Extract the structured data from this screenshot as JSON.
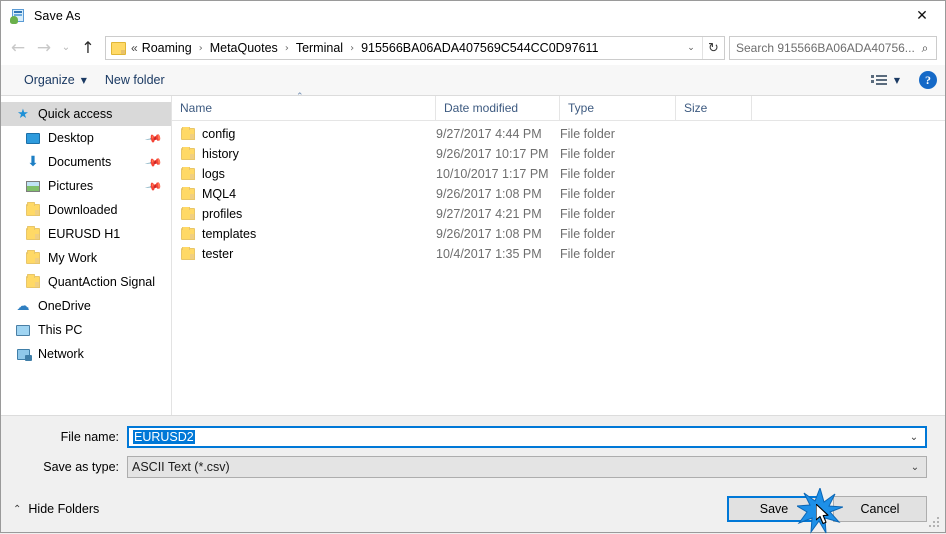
{
  "window": {
    "title": "Save As",
    "app_icon": "save-as-icon",
    "close_label": "✕"
  },
  "nav": {
    "back_icon": "←",
    "forward_icon": "→",
    "recent_icon": "⌄",
    "up_icon": "↑",
    "address": {
      "prefix": "«",
      "crumbs": [
        "Roaming",
        "MetaQuotes",
        "Terminal",
        "915566BA06ADA407569C544CC0D97611"
      ],
      "separator": "›",
      "dropdown_icon": "⌄",
      "refresh_icon": "↻"
    },
    "search": {
      "placeholder": "Search 915566BA06ADA40756...",
      "icon": "⌕"
    }
  },
  "toolbar": {
    "organize_label": "Organize",
    "organize_caret": "▼",
    "new_folder_label": "New folder",
    "view_caret": "▼",
    "help_label": "?"
  },
  "sidebar": {
    "items": [
      {
        "label": "Quick access",
        "icon": "star-icon",
        "selected": true,
        "pinned": false,
        "root": true
      },
      {
        "label": "Desktop",
        "icon": "desktop-icon",
        "selected": false,
        "pinned": true,
        "root": false
      },
      {
        "label": "Documents",
        "icon": "documents-icon",
        "selected": false,
        "pinned": true,
        "root": false
      },
      {
        "label": "Pictures",
        "icon": "pictures-icon",
        "selected": false,
        "pinned": true,
        "root": false
      },
      {
        "label": "Downloaded",
        "icon": "folder-icon",
        "selected": false,
        "pinned": false,
        "root": false
      },
      {
        "label": "EURUSD H1",
        "icon": "folder-icon",
        "selected": false,
        "pinned": false,
        "root": false
      },
      {
        "label": "My Work",
        "icon": "folder-icon",
        "selected": false,
        "pinned": false,
        "root": false
      },
      {
        "label": "QuantAction Signal",
        "icon": "folder-icon",
        "selected": false,
        "pinned": false,
        "root": false
      },
      {
        "label": "OneDrive",
        "icon": "onedrive-icon",
        "selected": false,
        "pinned": false,
        "root": true
      },
      {
        "label": "This PC",
        "icon": "this-pc-icon",
        "selected": false,
        "pinned": false,
        "root": true
      },
      {
        "label": "Network",
        "icon": "network-icon",
        "selected": false,
        "pinned": false,
        "root": true
      }
    ]
  },
  "filelist": {
    "columns": [
      "Name",
      "Date modified",
      "Type",
      "Size"
    ],
    "sort_caret": "⌃",
    "rows": [
      {
        "name": "config",
        "date": "9/27/2017 4:44 PM",
        "type": "File folder",
        "size": ""
      },
      {
        "name": "history",
        "date": "9/26/2017 10:17 PM",
        "type": "File folder",
        "size": ""
      },
      {
        "name": "logs",
        "date": "10/10/2017 1:17 PM",
        "type": "File folder",
        "size": ""
      },
      {
        "name": "MQL4",
        "date": "9/26/2017 1:08 PM",
        "type": "File folder",
        "size": ""
      },
      {
        "name": "profiles",
        "date": "9/27/2017 4:21 PM",
        "type": "File folder",
        "size": ""
      },
      {
        "name": "templates",
        "date": "9/26/2017 1:08 PM",
        "type": "File folder",
        "size": ""
      },
      {
        "name": "tester",
        "date": "10/4/2017 1:35 PM",
        "type": "File folder",
        "size": ""
      }
    ]
  },
  "form": {
    "filename_label": "File name:",
    "filename_value": "EURUSD2",
    "filetype_label": "Save as type:",
    "filetype_value": "ASCII Text (*.csv)",
    "caret_icon": "⌄"
  },
  "footer": {
    "hide_folders_label": "Hide Folders",
    "hide_folders_caret": "⌃",
    "save_label": "Save",
    "cancel_label": "Cancel"
  },
  "colors": {
    "accent": "#0078d7",
    "selection": "#0078d7",
    "folder": "#ffd966",
    "header_text": "#3d5a80",
    "help_blue": "#1569c7"
  }
}
